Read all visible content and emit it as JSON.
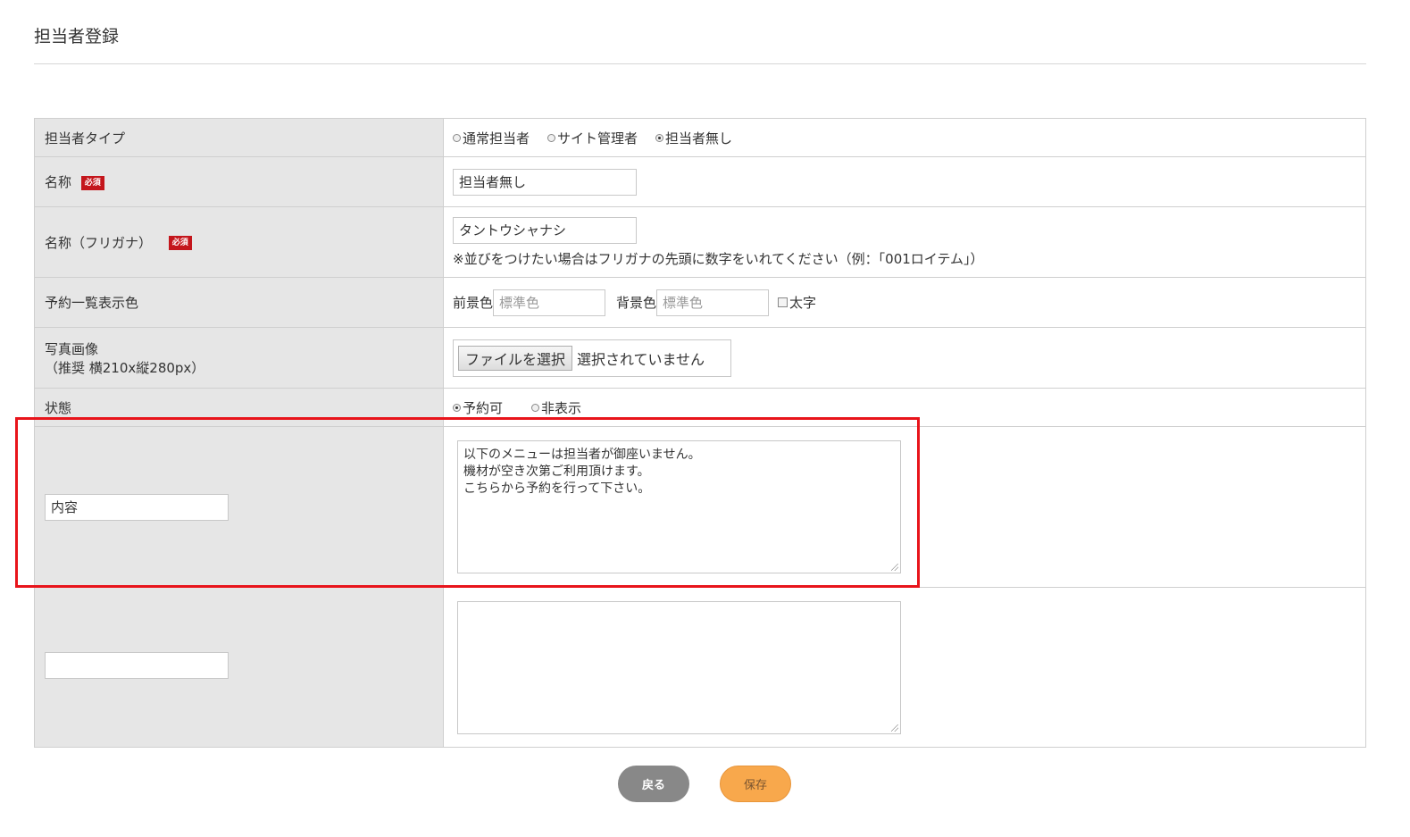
{
  "page": {
    "title": "担当者登録"
  },
  "form": {
    "staff_type": {
      "label": "担当者タイプ",
      "options": [
        {
          "label": "通常担当者",
          "checked": false
        },
        {
          "label": "サイト管理者",
          "checked": false
        },
        {
          "label": "担当者無し",
          "checked": true
        }
      ]
    },
    "name": {
      "label": "名称",
      "required_badge": "必須",
      "value": "担当者無し"
    },
    "name_kana": {
      "label": "名称（フリガナ）",
      "required_badge": "必須",
      "value": "タントウシャナシ",
      "hint": "※並びをつけたい場合はフリガナの先頭に数字をいれてください（例：「001ロイテム」）"
    },
    "display_color": {
      "label": "予約一覧表示色",
      "fg_label": "前景色",
      "fg_placeholder": "標準色",
      "bg_label": "背景色",
      "bg_placeholder": "標準色",
      "bold_label": "太字",
      "bold_checked": false
    },
    "photo": {
      "label": "写真画像",
      "label_note": "（推奨 横210x縦280px）",
      "button_label": "ファイルを選択",
      "status": "選択されていません"
    },
    "status": {
      "label": "状態",
      "options": [
        {
          "label": "予約可",
          "checked": true
        },
        {
          "label": "非表示",
          "checked": false
        }
      ]
    },
    "content1": {
      "key": "内容",
      "lines": [
        "以下のメニューは担当者が御座いません。",
        "機材が空き次第ご利用頂けます。",
        "こちらから予約を行って下さい。"
      ]
    },
    "content2": {
      "key": "",
      "lines": []
    }
  },
  "buttons": {
    "back_label": "戻る",
    "save_label": "保存"
  },
  "colors": {
    "required_badge": "#c4161c",
    "highlight": "#e8141b",
    "save_button": "#f8a84c",
    "back_button": "#888888"
  }
}
